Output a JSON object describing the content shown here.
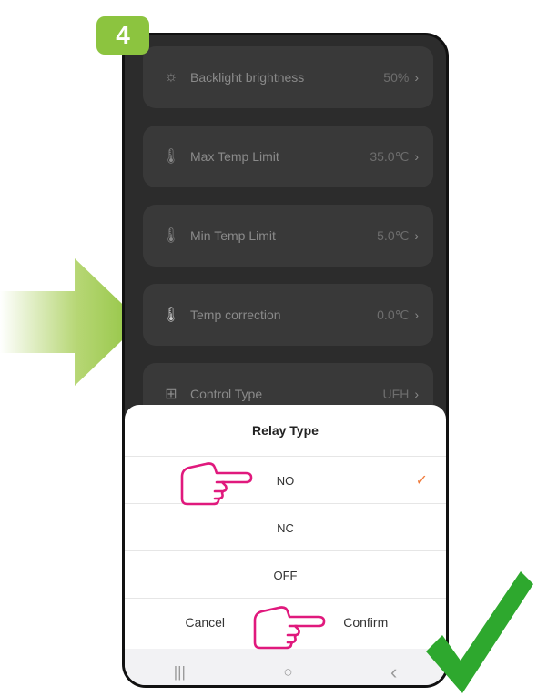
{
  "step": "4",
  "settings": [
    {
      "label": "Backlight brightness",
      "value": "50%",
      "icon": "sun-icon"
    },
    {
      "label": "Max Temp Limit",
      "value": "35.0℃",
      "icon": "thermometer-icon"
    },
    {
      "label": "Min Temp Limit",
      "value": "5.0℃",
      "icon": "thermometer-icon"
    },
    {
      "label": "Temp correction",
      "value": "0.0℃",
      "icon": "thermometer-filled-icon"
    },
    {
      "label": "Control Type",
      "value": "UFH",
      "icon": "grid-icon"
    }
  ],
  "dialog": {
    "title": "Relay Type",
    "options": [
      {
        "label": "NO",
        "selected": true
      },
      {
        "label": "NC",
        "selected": false
      },
      {
        "label": "OFF",
        "selected": false
      }
    ],
    "cancel": "Cancel",
    "confirm": "Confirm"
  },
  "navbar": {
    "recent": "|||",
    "home": "○",
    "back": "‹"
  },
  "colors": {
    "badge": "#8cc43f",
    "check_accent": "#f07a3a",
    "hand_pointer": "#e0197d",
    "big_check": "#2ea82e",
    "arrow": "#a9cf5b"
  }
}
